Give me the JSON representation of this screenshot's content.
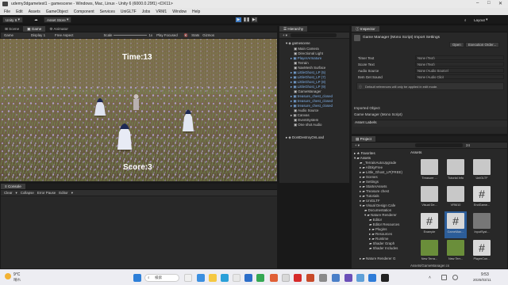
{
  "window": {
    "title": "udemy3dgametest1 - gamescene - Windows, Mac, Linux - Unity 6 (6000.0.29f1) <DX11>"
  },
  "menu": [
    "File",
    "Edit",
    "Assets",
    "GameObject",
    "Component",
    "Services",
    "UniGLTF",
    "Jobs",
    "VRM1",
    "Window",
    "Help"
  ],
  "toolbar": {
    "account": "Unity 6",
    "asset_store": "Asset Store",
    "layout": "Layout"
  },
  "game_panel": {
    "tabs": [
      "Scene",
      "Game",
      "Animator"
    ],
    "display_mode": "Game",
    "display": "Display 1",
    "aspect": "Free Aspect",
    "scale_label": "Scale",
    "scale_value": "1x",
    "play_focused": "Play Focused",
    "stats": "Stats",
    "gizmos": "Gizmos",
    "hud": {
      "time": "Time:13",
      "score": "Score:3"
    }
  },
  "hierarchy": {
    "tab": "Hierarchy",
    "scene": "gamescene",
    "items": [
      "Main Camera",
      "Directional Light",
      "PlayerArmature",
      "Terrain",
      "NavMesh Surface",
      "LittleGhost_LP (5)",
      "LittleGhost_LP (7)",
      "LittleGhost_LP (8)",
      "LittleGhost_LP (9)",
      "GameManager",
      "treasure_chest_closed",
      "treasure_chest_closed",
      "treasure_chest_closed",
      "Audio Source",
      "Canvas",
      "EventSystem",
      "One shot Audio",
      "DontDestroyOnLoad"
    ]
  },
  "inspector": {
    "tab": "Inspector",
    "header": "Game Manager (Mono Script) Import Settings",
    "open": "Open",
    "exec_order": "Execution Order...",
    "fields": [
      {
        "label": "Timer Text",
        "value": "None (Text)"
      },
      {
        "label": "Score Text",
        "value": "None (Text)"
      },
      {
        "label": "Audio Source",
        "value": "None (Audio Source)"
      },
      {
        "label": "Item Get Sound",
        "value": "None (Audio Clip)"
      }
    ],
    "note": "Default references will only be applied in edit mode.",
    "imported_object": "Imported Object",
    "imported_name": "Game Manager (Mono Script)",
    "asset_labels": "Asset Labels"
  },
  "console": {
    "tab": "Console",
    "buttons": [
      "Clear",
      "Collapse",
      "Error Pause",
      "Editor"
    ]
  },
  "project": {
    "tab": "Project",
    "favorites": "Favorites",
    "tree": [
      "Assets",
      "_TerrainAutoUpgrade",
      "AllSkyFree",
      "Little_Ghost_LP(FREE)",
      "Scenes",
      "Settings",
      "StarterAssets",
      "Treasure chest",
      "Tutorials",
      "UniGLTF",
      "Visual Design Cafe",
      "Documentation",
      "Nature Renderer",
      "Editor",
      "Editor Resources",
      "Plugins",
      "Resources",
      "Runtime",
      "Shader Graph",
      "Shader Includes",
      "Nature Renderer G"
    ],
    "breadcrumb": "Assets",
    "assets": [
      {
        "name": "Treasure ...",
        "kind": "folder"
      },
      {
        "name": "Tutorial Info",
        "kind": "folder"
      },
      {
        "name": "UniGLTF",
        "kind": "folder"
      },
      {
        "name": "Visual De...",
        "kind": "folder"
      },
      {
        "name": "VRM10",
        "kind": "folder"
      },
      {
        "name": "EndGame...",
        "kind": "script"
      },
      {
        "name": "Example",
        "kind": "script"
      },
      {
        "name": "GameMan...",
        "kind": "script"
      },
      {
        "name": "InputSyst...",
        "kind": "asset"
      },
      {
        "name": "New Terra...",
        "kind": "terrain"
      },
      {
        "name": "New Terr...",
        "kind": "terrain"
      },
      {
        "name": "PlayerCon...",
        "kind": "script"
      }
    ],
    "path": "Assets/GameManager.cs",
    "count": "24"
  },
  "taskbar": {
    "weather_temp": "9°C",
    "weather_desc": "晴れ",
    "search": "検索",
    "time": "9:53",
    "date": "2025/03/11"
  },
  "colors": {
    "accent": "#3a79c4",
    "panel": "#282828"
  }
}
